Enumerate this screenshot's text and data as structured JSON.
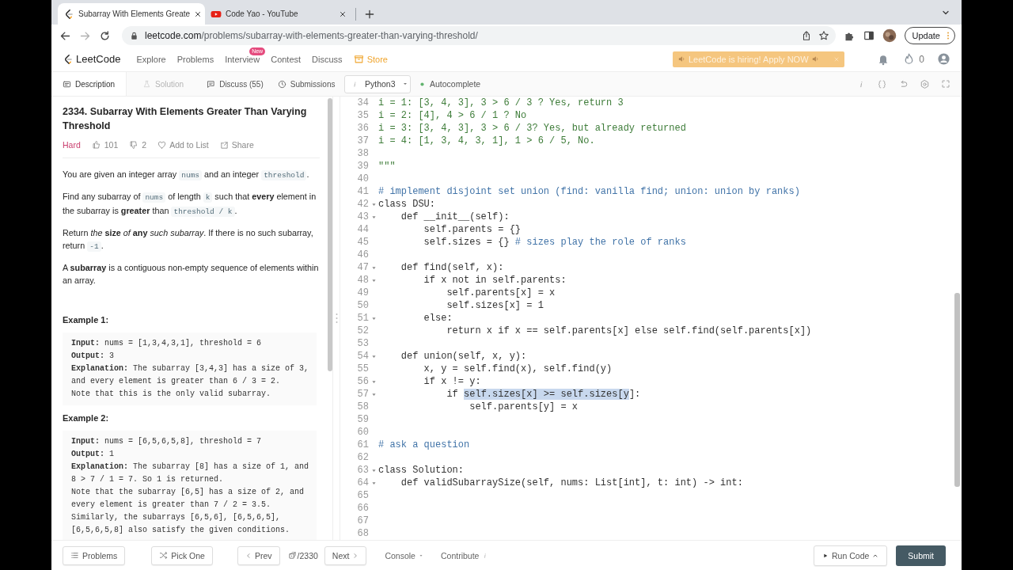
{
  "browser": {
    "tabs": [
      {
        "title": "Subarray With Elements Greate",
        "kind": "leetcode",
        "selected": true
      },
      {
        "title": "Code Yao - YouTube",
        "kind": "video",
        "selected": false
      }
    ],
    "url": {
      "domain": "leetcode.com",
      "path": "/problems/subarray-with-elements-greater-than-varying-threshold/"
    },
    "update_button": "Update"
  },
  "nav": {
    "logo": "LeetCode",
    "items": [
      {
        "label": "Explore",
        "kind": "link"
      },
      {
        "label": "Problems",
        "kind": "link"
      },
      {
        "label": "Interview",
        "kind": "link",
        "badge": "New"
      },
      {
        "label": "Contest",
        "kind": "link"
      },
      {
        "label": "Discuss",
        "kind": "link"
      },
      {
        "label": "Store",
        "kind": "store"
      }
    ],
    "banner": "LeetCode is hiring! Apply NOW",
    "streak": "0"
  },
  "panel_tabs": [
    {
      "label": "Description",
      "kind": "description",
      "selected": true,
      "disabled": false
    },
    {
      "label": "Solution",
      "kind": "solution",
      "selected": false,
      "disabled": true
    },
    {
      "label": "Discuss (55)",
      "kind": "discuss",
      "selected": false,
      "disabled": false
    },
    {
      "label": "Submissions",
      "kind": "submissions",
      "selected": false,
      "disabled": false
    }
  ],
  "editor_bar": {
    "language": "Python3",
    "autocomplete": {
      "label": "Autocomplete",
      "on": true
    }
  },
  "problem": {
    "title": "2334. Subarray With Elements Greater Than Varying Threshold",
    "difficulty": "Hard",
    "likes": "101",
    "dislikes": "2",
    "add_to_list": "Add to List",
    "share": "Share",
    "paragraphs": [
      [
        {
          "text": "You are given an integer array ",
          "kind": "text"
        },
        {
          "text": "nums",
          "kind": "code"
        },
        {
          "text": " and an integer ",
          "kind": "text"
        },
        {
          "text": "threshold",
          "kind": "code"
        },
        {
          "text": ".",
          "kind": "text"
        }
      ],
      [
        {
          "text": "Find any subarray of ",
          "kind": "text"
        },
        {
          "text": "nums",
          "kind": "code"
        },
        {
          "text": " of length ",
          "kind": "text"
        },
        {
          "text": "k",
          "kind": "code"
        },
        {
          "text": " such that **every** element in the subarray is **greater** than ",
          "kind": "text"
        },
        {
          "text": "threshold / k",
          "kind": "code"
        },
        {
          "text": ".",
          "kind": "text"
        }
      ],
      [
        {
          "text": "Return *the* **size** *of* **any** *such subarray*. If there is no such subarray, return ",
          "kind": "text"
        },
        {
          "text": "-1",
          "kind": "code"
        },
        {
          "text": ".",
          "kind": "text"
        }
      ],
      [
        {
          "text": "A **subarray** is a contiguous non-empty sequence of elements within an array.",
          "kind": "text"
        }
      ]
    ],
    "examples": [
      {
        "title": "Example 1:",
        "lines": [
          "**Input:** nums = [1,3,4,3,1], threshold = 6",
          "**Output:** 3",
          "**Explanation:** The subarray [3,4,3] has a size of 3,",
          "and every element is greater than 6 / 3 = 2.",
          "Note that this is the only valid subarray."
        ]
      },
      {
        "title": "Example 2:",
        "lines": [
          "**Input:** nums = [6,5,6,5,8], threshold = 7",
          "**Output:** 1",
          "**Explanation:** The subarray [8] has a size of 1, and",
          "8 > 7 / 1 = 7. So 1 is returned.",
          "Note that the subarray [6,5] has a size of 2, and",
          "every element is greater than 7 / 2 = 3.5.",
          "Similarly, the subarrays [6,5,6], [6,5,6,5],",
          "[6,5,6,5,8] also satisfy the given conditions."
        ]
      }
    ]
  },
  "code": {
    "lines": [
      {
        "number": "34",
        "foldable": false,
        "segments": [
          {
            "text": "i = 1: [3, 4, 3], 3 > 6 / 3 ? Yes, return 3",
            "kind": "doc"
          }
        ]
      },
      {
        "number": "35",
        "foldable": false,
        "segments": [
          {
            "text": "i = 2: [4], 4 > 6 / 1 ? No",
            "kind": "doc"
          }
        ]
      },
      {
        "number": "36",
        "foldable": false,
        "segments": [
          {
            "text": "i = 3: [3, 4, 3], 3 > 6 / 3? Yes, but already returned",
            "kind": "doc"
          }
        ]
      },
      {
        "number": "37",
        "foldable": false,
        "segments": [
          {
            "text": "i = 4: [1, 3, 4, 3, 1], 1 > 6 / 5, No.",
            "kind": "doc"
          }
        ]
      },
      {
        "number": "38",
        "foldable": false
      },
      {
        "number": "39",
        "foldable": false,
        "segments": [
          {
            "text": "\"\"\"",
            "kind": "doc"
          }
        ]
      },
      {
        "number": "40",
        "foldable": false
      },
      {
        "number": "41",
        "foldable": false,
        "segments": [
          {
            "text": "# implement disjoint set union (find: vanilla find; union: union by ranks)",
            "kind": "comment"
          }
        ]
      },
      {
        "number": "42",
        "foldable": true,
        "segments": [
          {
            "text": "class DSU:",
            "kind": "plain"
          }
        ]
      },
      {
        "number": "43",
        "foldable": true,
        "segments": [
          {
            "text": "    def __init__(self):",
            "kind": "plain"
          }
        ]
      },
      {
        "number": "44",
        "foldable": false,
        "segments": [
          {
            "text": "        self.parents = {}",
            "kind": "plain"
          }
        ]
      },
      {
        "number": "45",
        "foldable": false,
        "segments": [
          {
            "text": "        self.sizes = {} ",
            "kind": "plain"
          },
          {
            "text": "# sizes play the role of ranks",
            "kind": "comment"
          }
        ]
      },
      {
        "number": "46",
        "foldable": false
      },
      {
        "number": "47",
        "foldable": true,
        "segments": [
          {
            "text": "    def find(self, x):",
            "kind": "plain"
          }
        ]
      },
      {
        "number": "48",
        "foldable": true,
        "segments": [
          {
            "text": "        if x not in self.parents:",
            "kind": "plain"
          }
        ]
      },
      {
        "number": "49",
        "foldable": false,
        "segments": [
          {
            "text": "            self.parents[x] = x",
            "kind": "plain"
          }
        ]
      },
      {
        "number": "50",
        "foldable": false,
        "segments": [
          {
            "text": "            self.sizes[x] = 1",
            "kind": "plain"
          }
        ]
      },
      {
        "number": "51",
        "foldable": true,
        "segments": [
          {
            "text": "        else:",
            "kind": "plain"
          }
        ]
      },
      {
        "number": "52",
        "foldable": false,
        "segments": [
          {
            "text": "            return x if x == self.parents[x] else self.find(self.parents[x])",
            "kind": "plain"
          }
        ]
      },
      {
        "number": "53",
        "foldable": false
      },
      {
        "number": "54",
        "foldable": true,
        "segments": [
          {
            "text": "    def union(self, x, y):",
            "kind": "plain"
          }
        ]
      },
      {
        "number": "55",
        "foldable": false,
        "segments": [
          {
            "text": "        x, y = self.find(x), self.find(y)",
            "kind": "plain"
          }
        ]
      },
      {
        "number": "56",
        "foldable": true,
        "segments": [
          {
            "text": "        if x != y:",
            "kind": "plain"
          }
        ]
      },
      {
        "number": "57",
        "foldable": true,
        "segments": [
          {
            "text": "            if ",
            "kind": "plain"
          },
          {
            "text": "self.sizes[x] >= self.sizes[y",
            "kind": "selected"
          },
          {
            "text": "]:",
            "kind": "plain"
          }
        ]
      },
      {
        "number": "58",
        "foldable": false,
        "segments": [
          {
            "text": "                self.parents[y] = x",
            "kind": "plain"
          }
        ]
      },
      {
        "number": "59",
        "foldable": false
      },
      {
        "number": "60",
        "foldable": false
      },
      {
        "number": "61",
        "foldable": false,
        "segments": [
          {
            "text": "# ask a question",
            "kind": "comment"
          }
        ]
      },
      {
        "number": "62",
        "foldable": false
      },
      {
        "number": "63",
        "foldable": true,
        "segments": [
          {
            "text": "class Solution:",
            "kind": "plain"
          }
        ]
      },
      {
        "number": "64",
        "foldable": true,
        "segments": [
          {
            "text": "    def validSubarraySize(self, nums: List[int], t: int) -> int:",
            "kind": "plain"
          }
        ]
      },
      {
        "number": "65",
        "foldable": false
      },
      {
        "number": "66",
        "foldable": false
      },
      {
        "number": "67",
        "foldable": false
      },
      {
        "number": "68",
        "foldable": false
      }
    ]
  },
  "footer": {
    "problems": "Problems",
    "pick_one": "Pick One",
    "prev": "Prev",
    "counter": "/2330",
    "next": "Next",
    "console": "Console",
    "contribute": "Contribute",
    "run_code": "Run Code",
    "submit": "Submit"
  }
}
